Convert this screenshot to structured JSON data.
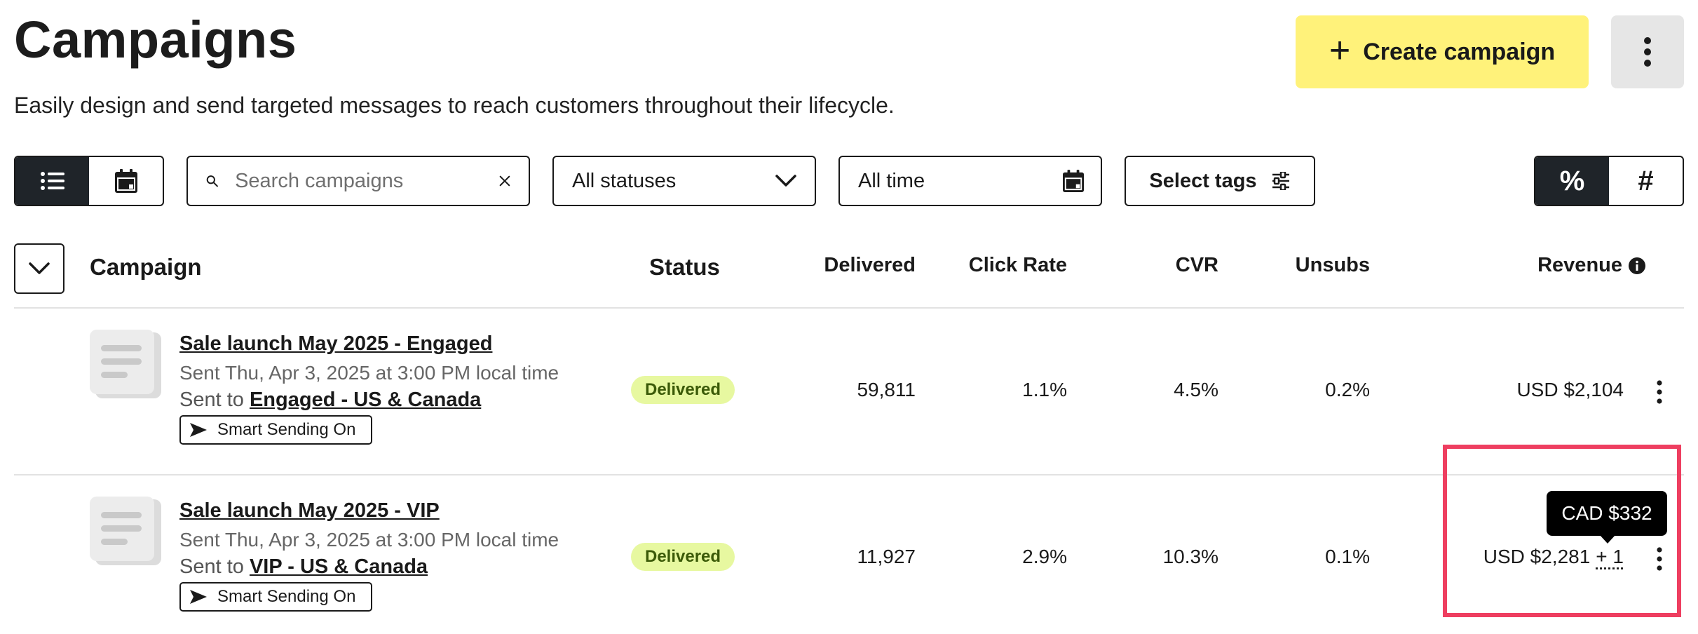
{
  "header": {
    "title": "Campaigns",
    "subtitle": "Easily design and send targeted messages to reach customers throughout their lifecycle.",
    "create_button": "Create campaign"
  },
  "toolbar": {
    "search_placeholder": "Search campaigns",
    "status_select": "All statuses",
    "time_select": "All time",
    "tags_button": "Select tags",
    "metric_percent": "%",
    "metric_number": "#"
  },
  "table": {
    "columns": {
      "campaign": "Campaign",
      "status": "Status",
      "delivered": "Delivered",
      "click_rate": "Click Rate",
      "cvr": "CVR",
      "unsubs": "Unsubs",
      "revenue": "Revenue"
    },
    "rows": [
      {
        "name": "Sale launch May 2025 - Engaged",
        "sent": "Sent Thu, Apr 3, 2025 at 3:00 PM local time",
        "sent_to_prefix": "Sent to",
        "segment": "Engaged - US & Canada",
        "badge": "Smart Sending On",
        "status": "Delivered",
        "delivered": "59,811",
        "click_rate": "1.1%",
        "cvr": "4.5%",
        "unsubs": "0.2%",
        "revenue": "USD $2,104",
        "revenue_more": ""
      },
      {
        "name": "Sale launch May 2025 - VIP",
        "sent": "Sent Thu, Apr 3, 2025 at 3:00 PM local time",
        "sent_to_prefix": "Sent to",
        "segment": "VIP - US & Canada",
        "badge": "Smart Sending On",
        "status": "Delivered",
        "delivered": "11,927",
        "click_rate": "2.9%",
        "cvr": "10.3%",
        "unsubs": "0.1%",
        "revenue": "USD $2,281",
        "revenue_more": "+ 1"
      }
    ]
  },
  "tooltip": {
    "text": "CAD $332"
  },
  "colors": {
    "accent_yellow": "#fff27a",
    "status_pill_bg": "#e7f8a0",
    "status_pill_text": "#3b5a08",
    "highlight": "#ee3e60",
    "dark": "#1f2429"
  }
}
